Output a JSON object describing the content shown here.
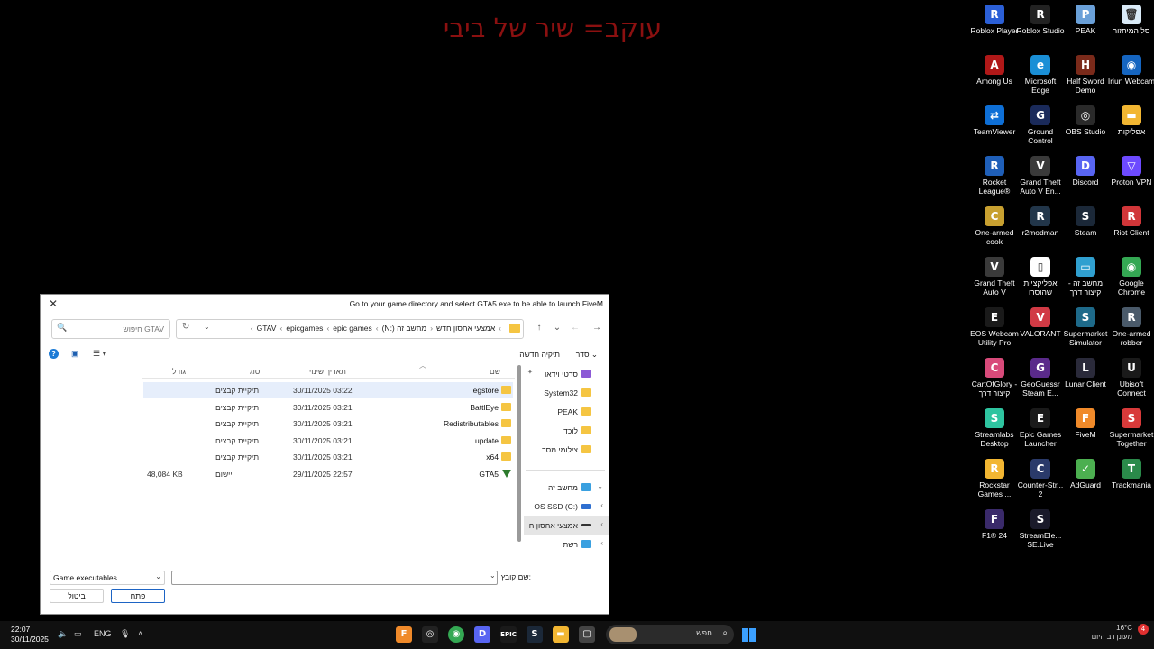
{
  "banner": "עוקב= שיר של ביבי",
  "desktop_icons": [
    {
      "label": "Roblox Player",
      "name": "roblox-player-icon",
      "color": "#2b5fd6",
      "glyph": "R"
    },
    {
      "label": "Roblox Studio",
      "name": "roblox-studio-icon",
      "color": "#222222",
      "glyph": "R"
    },
    {
      "label": "PEAK",
      "name": "peak-game-icon",
      "color": "#6aa0d8",
      "glyph": "P"
    },
    {
      "label": "סל המיחזור",
      "name": "recycle-bin-icon",
      "color": "#d9eaf7",
      "glyph": "🗑"
    },
    {
      "label": "Among Us",
      "name": "among-us-icon",
      "color": "#b01818",
      "glyph": "A"
    },
    {
      "label": "Microsoft Edge",
      "name": "edge-icon",
      "color": "#1a8fd6",
      "glyph": "e"
    },
    {
      "label": "Half Sword Demo",
      "name": "half-sword-icon",
      "color": "#7a2a1a",
      "glyph": "H"
    },
    {
      "label": "Iriun Webcam",
      "name": "iriun-webcam-icon",
      "color": "#1565c0",
      "glyph": "◉"
    },
    {
      "label": "TeamViewer",
      "name": "teamviewer-icon",
      "color": "#0e6fd6",
      "glyph": "⇄"
    },
    {
      "label": "Ground Control",
      "name": "ground-control-icon",
      "color": "#1a2a5a",
      "glyph": "G"
    },
    {
      "label": "OBS Studio",
      "name": "obs-studio-icon",
      "color": "#2a2a2a",
      "glyph": "◎"
    },
    {
      "label": "אפליקות",
      "name": "apps-folder-icon",
      "color": "#f2b632",
      "glyph": "▬"
    },
    {
      "label": "Rocket League®",
      "name": "rocket-league-icon",
      "color": "#1f5fb8",
      "glyph": "R"
    },
    {
      "label": "Grand Theft Auto V En...",
      "name": "gta-v-enhanced-icon",
      "color": "#3a3a3a",
      "glyph": "V"
    },
    {
      "label": "Discord",
      "name": "discord-icon",
      "color": "#5865f2",
      "glyph": "D"
    },
    {
      "label": "Proton VPN",
      "name": "proton-vpn-icon",
      "color": "#6d4aff",
      "glyph": "▽"
    },
    {
      "label": "One-armed cook",
      "name": "one-armed-cook-icon",
      "color": "#c8a030",
      "glyph": "C"
    },
    {
      "label": "r2modman",
      "name": "r2modman-icon",
      "color": "#22364a",
      "glyph": "R"
    },
    {
      "label": "Steam",
      "name": "steam-icon",
      "color": "#1b2838",
      "glyph": "S"
    },
    {
      "label": "Riot Client",
      "name": "riot-client-icon",
      "color": "#d13639",
      "glyph": "R"
    },
    {
      "label": "Grand Theft Auto V",
      "name": "gta-v-icon",
      "color": "#3a3a3a",
      "glyph": "V"
    },
    {
      "label": "אפליקציות שהוסרו",
      "name": "removed-apps-icon",
      "color": "#ffffff",
      "glyph": "▯"
    },
    {
      "label": "מחשב זה - קיצור דרך",
      "name": "this-pc-shortcut-icon",
      "color": "#30a0d0",
      "glyph": "▭"
    },
    {
      "label": "Google Chrome",
      "name": "chrome-icon",
      "color": "#34a853",
      "glyph": "◉"
    },
    {
      "label": "EOS Webcam Utility Pro",
      "name": "eos-webcam-icon",
      "color": "#1a1a1a",
      "glyph": "E"
    },
    {
      "label": "VALORANT",
      "name": "valorant-icon",
      "color": "#d13a45",
      "glyph": "V"
    },
    {
      "label": "Supermarket Simulator",
      "name": "supermarket-simulator-icon",
      "color": "#1e6a8a",
      "glyph": "S"
    },
    {
      "label": "One-armed robber",
      "name": "one-armed-robber-icon",
      "color": "#4a5a6a",
      "glyph": "R"
    },
    {
      "label": "CartOfGlory - קיצור דרך",
      "name": "cart-of-glory-icon",
      "color": "#d84a7a",
      "glyph": "C"
    },
    {
      "label": "GeoGuessr Steam E...",
      "name": "geoguessr-icon",
      "color": "#5a2a8a",
      "glyph": "G"
    },
    {
      "label": "Lunar Client",
      "name": "lunar-client-icon",
      "color": "#2a2a3a",
      "glyph": "L"
    },
    {
      "label": "Ubisoft Connect",
      "name": "ubisoft-connect-icon",
      "color": "#1a1a1a",
      "glyph": "U"
    },
    {
      "label": "Streamlabs Desktop",
      "name": "streamlabs-icon",
      "color": "#2ec4a0",
      "glyph": "S"
    },
    {
      "label": "Epic Games Launcher",
      "name": "epic-games-icon",
      "color": "#1a1a1a",
      "glyph": "E"
    },
    {
      "label": "FiveM",
      "name": "fivem-icon",
      "color": "#f08a2a",
      "glyph": "F"
    },
    {
      "label": "Supermarket Together",
      "name": "supermarket-together-icon",
      "color": "#d83a3a",
      "glyph": "S"
    },
    {
      "label": "Rockstar Games ...",
      "name": "rockstar-launcher-icon",
      "color": "#f2b632",
      "glyph": "R"
    },
    {
      "label": "Counter-Str... 2",
      "name": "counter-strike-icon",
      "color": "#2a3a6a",
      "glyph": "C"
    },
    {
      "label": "AdGuard",
      "name": "adguard-icon",
      "color": "#4caf50",
      "glyph": "✓"
    },
    {
      "label": "Trackmania",
      "name": "trackmania-icon",
      "color": "#2a8a4a",
      "glyph": "T"
    },
    {
      "label": "F1® 24",
      "name": "f1-24-icon",
      "color": "#3a2a6a",
      "glyph": "F"
    },
    {
      "label": "StreamEle... SE.Live",
      "name": "streamelements-icon",
      "color": "#1a1a2a",
      "glyph": "S"
    }
  ],
  "dialog": {
    "title": "Go to your game directory and select GTA5.exe to be able to launch FiveM",
    "breadcrumb": [
      "GTAV",
      "epicgames",
      "epic games",
      "(N:) אמצעי אחסון חדש",
      "מחשב זה"
    ],
    "search_placeholder": "חיפוש GTAV",
    "toolbar": {
      "sort": "סדר",
      "new_folder": "תיקיה חדשה"
    },
    "columns": {
      "name": "שם",
      "date": "תאריך שינוי",
      "type": "סוג",
      "size": "גודל"
    },
    "files": [
      {
        "name": ".egstore",
        "date": "30/11/2025 03:22",
        "type": "תיקיית קבצים",
        "size": "",
        "kind": "folder",
        "selected": true
      },
      {
        "name": "BattlEye",
        "date": "30/11/2025 03:21",
        "type": "תיקיית קבצים",
        "size": "",
        "kind": "folder",
        "selected": false
      },
      {
        "name": "Redistributables",
        "date": "30/11/2025 03:21",
        "type": "תיקיית קבצים",
        "size": "",
        "kind": "folder",
        "selected": false
      },
      {
        "name": "update",
        "date": "30/11/2025 03:21",
        "type": "תיקיית קבצים",
        "size": "",
        "kind": "folder",
        "selected": false
      },
      {
        "name": "x64",
        "date": "30/11/2025 03:21",
        "type": "תיקיית קבצים",
        "size": "",
        "kind": "folder",
        "selected": false
      },
      {
        "name": "GTA5",
        "date": "29/11/2025 22:57",
        "type": "יישום",
        "size": "48,084 KB",
        "kind": "exe",
        "selected": false
      }
    ],
    "nav_items": [
      {
        "label": "סרטי וידאו",
        "kind": "purple",
        "pin": true
      },
      {
        "label": "System32",
        "kind": "folder",
        "pin": false
      },
      {
        "label": "PEAK",
        "kind": "folder",
        "pin": false
      },
      {
        "label": "לוכד",
        "kind": "folder",
        "pin": false
      },
      {
        "label": "צילומי מסך",
        "kind": "folder",
        "pin": false
      },
      {
        "label": "מחשב זה",
        "kind": "blue",
        "chev": "⌄"
      },
      {
        "label": "OS SSD (C:)",
        "kind": "drive",
        "chev": "‹"
      },
      {
        "label": "אמצעי אחסון ח",
        "kind": "drive2",
        "chev": "‹",
        "selected": true
      },
      {
        "label": "רשת",
        "kind": "blue",
        "chev": "‹"
      }
    ],
    "filename_label": "שם קובץ:",
    "filename_value": "",
    "filter": "Game executables",
    "open_label": "פתח",
    "cancel_label": "ביטול"
  },
  "taskbar": {
    "time": "22:07",
    "date": "30/11/2025",
    "lang": "ENG",
    "search_label": "חפש",
    "weather_temp": "16°C",
    "weather_desc": "מעונן רב היום",
    "notif_count": "4"
  }
}
